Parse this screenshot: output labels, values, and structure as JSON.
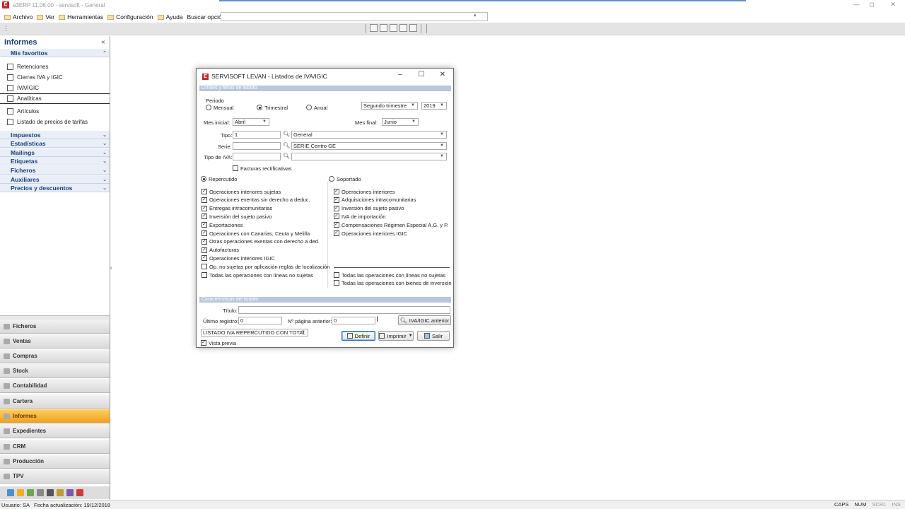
{
  "window": {
    "title": "a3ERP 11.06.00 - servisoft - General",
    "min": "—",
    "max": "◻",
    "close": "✕"
  },
  "menu": {
    "items": [
      "Archivo",
      "Ver",
      "Herramientas",
      "Configuración",
      "Ayuda"
    ],
    "search_label": "Buscar opción:",
    "search_value": ""
  },
  "left_panel": {
    "title": "Informes",
    "favorites_header": "Mis favoritos",
    "favorites": [
      "Retenciones",
      "Cierres IVA y IGIC",
      "IVA/IGIC",
      "Analíticas",
      "Artículos",
      "Listado de precios de tarifas"
    ],
    "groups": [
      "Impuestos",
      "Estadísticas",
      "Mailings",
      "Etiquetas",
      "Ficheros",
      "Auxiliares",
      "Precios y descuentos"
    ],
    "modules": [
      "Ficheros",
      "Ventas",
      "Compras",
      "Stock",
      "Contabilidad",
      "Cartera",
      "Informes",
      "Expedientes",
      "CRM",
      "Producción",
      "TPV"
    ],
    "active_module": "Informes"
  },
  "status": {
    "user": "Usuario: SA",
    "date": "Fecha actualización: 19/12/2018",
    "caps": "CAPS",
    "num": "NUM",
    "scrl": "SCRL",
    "ins": "INS"
  },
  "dialog": {
    "title": "SERVISOFT LEVAN - Listados de IVA/IGIC",
    "section_limits": "Límites y filtros de listado",
    "periodo_label": "Periodo",
    "periodo_options": [
      "Mensual",
      "Trimestral",
      "Anual"
    ],
    "periodo_selected": "Trimestral",
    "trimestre": "Segundo trimestre",
    "year": "2019",
    "mes_inicial_label": "Mes inicial:",
    "mes_inicial": "Abril",
    "mes_final_label": "Mes final:",
    "mes_final": "Junio",
    "tipo_label": "Tipo:",
    "tipo_value": "1",
    "tipo_desc": "General",
    "serie_label": "Serie:",
    "serie_value": "",
    "serie_desc": "SERIE  Centro GE",
    "tipo_iva_label": "Tipo de IVA:",
    "tipo_iva_value": "",
    "tipo_iva_desc": "",
    "facturas_rect": "Facturas rectificativas",
    "repercutido": "Repercutido",
    "soportado": "Soportado",
    "rep_options": [
      {
        "label": "Operaciones interiores sujetas",
        "checked": true
      },
      {
        "label": "Operaciones exentas sin derecho a deduc.",
        "checked": true
      },
      {
        "label": "Entregas intracomunitarias",
        "checked": true
      },
      {
        "label": "Inversión del sujeto pasivo",
        "checked": true
      },
      {
        "label": "Exportaciones",
        "checked": true
      },
      {
        "label": "Operaciones con Canarias, Ceuta y Melilla",
        "checked": true
      },
      {
        "label": "Otras operaciones exentas con derecho a ded.",
        "checked": true
      },
      {
        "label": "Autofacturas",
        "checked": true
      },
      {
        "label": "Operaciones interiores IGIC",
        "checked": true
      },
      {
        "label": "Op. no sujetas por aplicación reglas de localización",
        "checked": false
      }
    ],
    "rep_all_no_sujetas": "Todas las operaciones con líneas no sujetas",
    "sop_options": [
      {
        "label": "Operaciones interiores",
        "checked": true
      },
      {
        "label": "Adquisiciones intracomunitarias",
        "checked": true
      },
      {
        "label": "Inversión del sujeto pasivo",
        "checked": true
      },
      {
        "label": "IVA de importación",
        "checked": true
      },
      {
        "label": "Compensaciones Régimen Especial A.G. y P.",
        "checked": true
      },
      {
        "label": "Operaciones interiores IGIC",
        "checked": true
      }
    ],
    "sop_all_no_sujetas": "Todas las operaciones con líneas no sujetas",
    "sop_all_bienes": "Todas las operaciones con bienes de inversión",
    "section_caract": "Características del listado",
    "titulo_label": "Título:",
    "titulo_value": "",
    "ultimo_label": "Último registro:",
    "ultimo_value": "0",
    "pagina_label": "Nº página anterior:",
    "pagina_value": "0",
    "iva_anterior_btn": "IVA/IGIC anterior",
    "listado_select": "LISTADO IVA REPERCUTIDO CON TOTAL F.",
    "definir_btn": "Definir",
    "imprimir_btn": "Imprimir",
    "salir_btn": "Salir",
    "vista_previa": "Vista previa"
  }
}
